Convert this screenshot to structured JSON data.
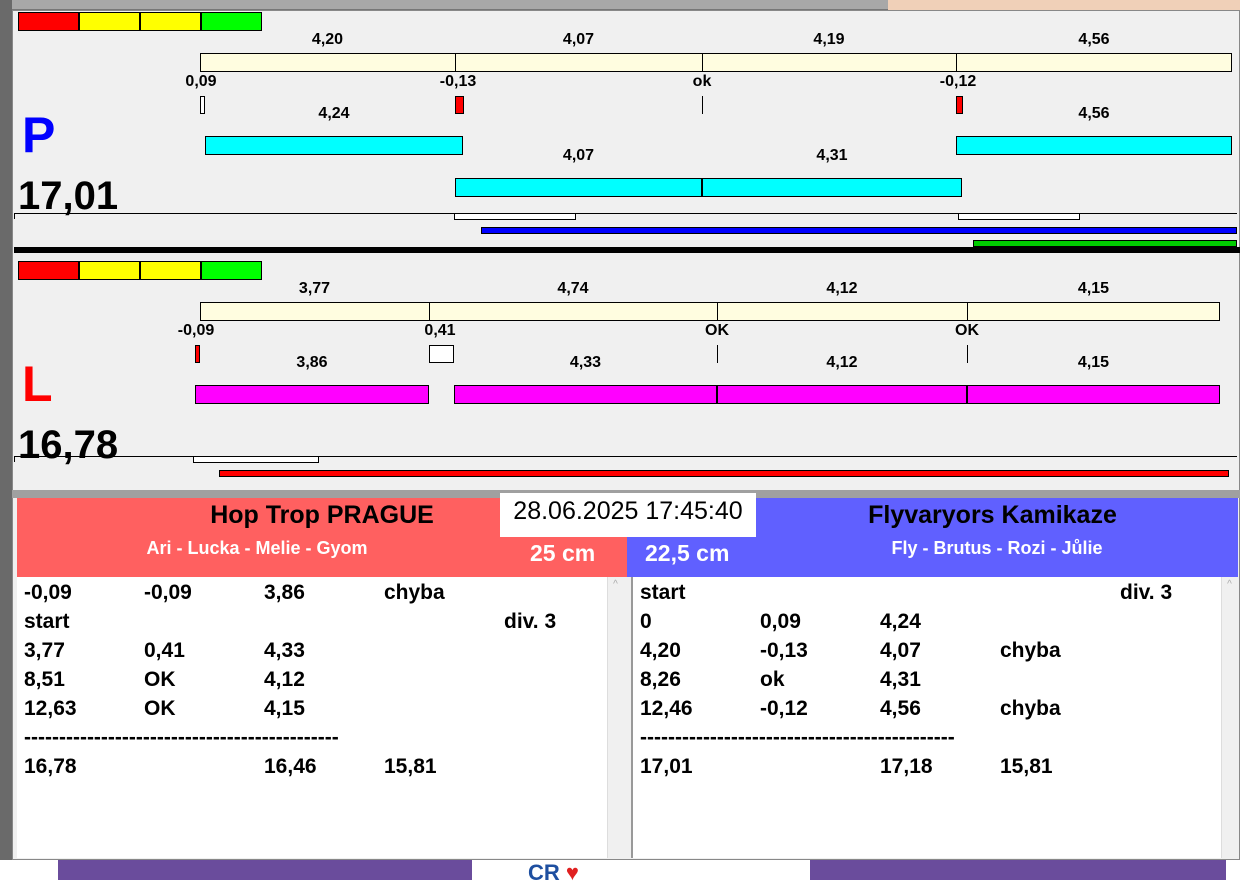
{
  "legend_colors": [
    "#ff0000",
    "#ffff00",
    "#ffff00",
    "#00ff00"
  ],
  "lane_p": {
    "letter": "P",
    "letter_color": "#0000ff",
    "total": "17,01",
    "segments": [
      "4,20",
      "4,07",
      "4,19",
      "4,56"
    ],
    "diffs": [
      "0,09",
      "-0,13",
      "ok",
      "-0,12"
    ],
    "runs_row1": [
      "4,24",
      "4,56"
    ],
    "runs_row2": [
      "4,07",
      "4,31"
    ],
    "run_color": "#00ffff",
    "progress_color": "#0000ff",
    "secondary_color": "#00cc00"
  },
  "lane_l": {
    "letter": "L",
    "letter_color": "#ff0000",
    "total": "16,78",
    "segments": [
      "3,77",
      "4,74",
      "4,12",
      "4,15"
    ],
    "diffs": [
      "-0,09",
      "0,41",
      "OK",
      "OK"
    ],
    "runs_row1": [
      "3,86",
      "4,33",
      "4,12",
      "4,15"
    ],
    "run_color": "#ff00ff",
    "progress_color": "#ff0000"
  },
  "datetime": "28.06.2025 17:45:40",
  "left_team": {
    "name": "Hop Trop PRAGUE",
    "members": "Ari - Lucka - Melie - Gyom",
    "height": "25 cm",
    "color": "#ff6060",
    "rows": [
      [
        "-0,09",
        "-0,09",
        "3,86",
        "chyba",
        ""
      ],
      [
        "start",
        "",
        "",
        "",
        "div.  3"
      ],
      [
        "3,77",
        "0,41",
        "4,33",
        "",
        ""
      ],
      [
        "8,51",
        "OK",
        "4,12",
        "",
        ""
      ],
      [
        "12,63",
        "OK",
        "4,15",
        "",
        ""
      ],
      [
        "---------------------------------------------",
        "",
        "",
        "",
        ""
      ],
      [
        "16,78",
        "",
        "16,46",
        "15,81",
        ""
      ]
    ]
  },
  "right_team": {
    "name": "Flyvaryors Kamikaze",
    "members": "Fly - Brutus - Rozi - Jůlie",
    "height": "22,5 cm",
    "color": "#6060ff",
    "rows": [
      [
        "start",
        "",
        "",
        "",
        "div.  3"
      ],
      [
        "0",
        "0,09",
        "4,24",
        "",
        ""
      ],
      [
        "4,20",
        "-0,13",
        "4,07",
        "chyba",
        ""
      ],
      [
        "8,26",
        "ok",
        "4,31",
        "",
        ""
      ],
      [
        "12,46",
        "-0,12",
        "4,56",
        "chyba",
        ""
      ],
      [
        "---------------------------------------------",
        "",
        "",
        "",
        ""
      ],
      [
        "17,01",
        "",
        "17,18",
        "15,81",
        ""
      ]
    ]
  }
}
